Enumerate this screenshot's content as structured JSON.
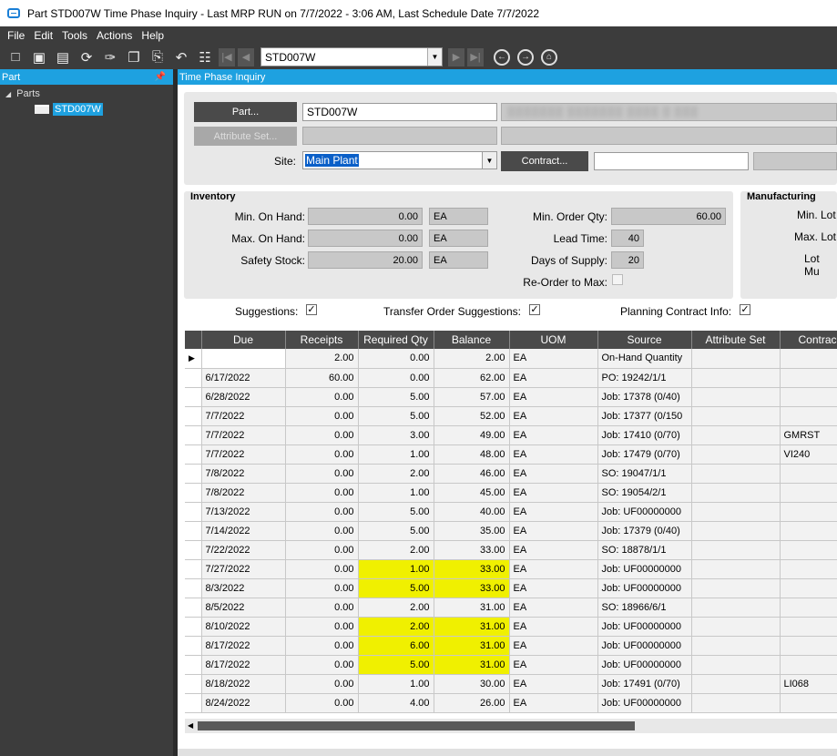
{
  "window": {
    "title": "Part STD007W Time Phase Inquiry  - Last MRP RUN on 7/7/2022 - 3:06 AM, Last Schedule Date  7/7/2022"
  },
  "menu": [
    "File",
    "Edit",
    "Tools",
    "Actions",
    "Help"
  ],
  "toolbar": {
    "part_combo": "STD007W"
  },
  "left": {
    "header": "Part",
    "root": "Parts",
    "item": "STD007W"
  },
  "main": {
    "header": "Time Phase Inquiry",
    "part_button": "Part...",
    "part_value": "STD007W",
    "part_desc": "░░░░░░░ ░░░░░░░ ░░░░ ░ ░░░",
    "attr_button": "Attribute Set...",
    "site_label": "Site:",
    "site_value": "Main Plant",
    "contract_button": "Contract..."
  },
  "inventory": {
    "title": "Inventory",
    "min_on_hand_label": "Min. On Hand:",
    "min_on_hand": "0.00",
    "min_on_hand_uom": "EA",
    "max_on_hand_label": "Max. On Hand:",
    "max_on_hand": "0.00",
    "max_on_hand_uom": "EA",
    "safety_label": "Safety Stock:",
    "safety": "20.00",
    "safety_uom": "EA",
    "min_order_label": "Min. Order Qty:",
    "min_order": "60.00",
    "lead_label": "Lead Time:",
    "lead": "40",
    "days_label": "Days of Supply:",
    "days": "20",
    "reorder_label": "Re-Order to Max:"
  },
  "manufacturing": {
    "title": "Manufacturing",
    "min_lot": "Min. Lot",
    "max_lot": "Max. Lot",
    "lot_mu": "Lot Mu"
  },
  "options": {
    "suggestions": "Suggestions:",
    "transfer": "Transfer Order Suggestions:",
    "planning": "Planning Contract Info:",
    "check": "✓"
  },
  "grid": {
    "columns": [
      "Due",
      "Receipts",
      "Required Qty",
      "Balance",
      "UOM",
      "Source",
      "Attribute Set",
      "Contrac"
    ],
    "rows": [
      {
        "due": "",
        "receipts": "2.00",
        "req": "0.00",
        "bal": "2.00",
        "uom": "EA",
        "source": "On-Hand Quantity",
        "attr": "",
        "contract": ""
      },
      {
        "due": "6/17/2022",
        "receipts": "60.00",
        "req": "0.00",
        "bal": "62.00",
        "uom": "EA",
        "source": "PO: 19242/1/1",
        "attr": "",
        "contract": ""
      },
      {
        "due": "6/28/2022",
        "receipts": "0.00",
        "req": "5.00",
        "bal": "57.00",
        "uom": "EA",
        "source": "Job: 17378 (0/40)",
        "attr": "",
        "contract": ""
      },
      {
        "due": "7/7/2022",
        "receipts": "0.00",
        "req": "5.00",
        "bal": "52.00",
        "uom": "EA",
        "source": "Job: 17377 (0/150",
        "attr": "",
        "contract": ""
      },
      {
        "due": "7/7/2022",
        "receipts": "0.00",
        "req": "3.00",
        "bal": "49.00",
        "uom": "EA",
        "source": "Job: 17410 (0/70)",
        "attr": "",
        "contract": "GMRST"
      },
      {
        "due": "7/7/2022",
        "receipts": "0.00",
        "req": "1.00",
        "bal": "48.00",
        "uom": "EA",
        "source": "Job: 17479 (0/70)",
        "attr": "",
        "contract": "VI240"
      },
      {
        "due": "7/8/2022",
        "receipts": "0.00",
        "req": "2.00",
        "bal": "46.00",
        "uom": "EA",
        "source": "SO: 19047/1/1",
        "attr": "",
        "contract": ""
      },
      {
        "due": "7/8/2022",
        "receipts": "0.00",
        "req": "1.00",
        "bal": "45.00",
        "uom": "EA",
        "source": "SO: 19054/2/1",
        "attr": "",
        "contract": ""
      },
      {
        "due": "7/13/2022",
        "receipts": "0.00",
        "req": "5.00",
        "bal": "40.00",
        "uom": "EA",
        "source": "Job: UF00000000",
        "attr": "",
        "contract": ""
      },
      {
        "due": "7/14/2022",
        "receipts": "0.00",
        "req": "5.00",
        "bal": "35.00",
        "uom": "EA",
        "source": "Job: 17379 (0/40)",
        "attr": "",
        "contract": ""
      },
      {
        "due": "7/22/2022",
        "receipts": "0.00",
        "req": "2.00",
        "bal": "33.00",
        "uom": "EA",
        "source": "SO: 18878/1/1",
        "attr": "",
        "contract": ""
      },
      {
        "due": "7/27/2022",
        "receipts": "0.00",
        "req": "1.00",
        "bal": "33.00",
        "uom": "EA",
        "source": "Job: UF00000000",
        "attr": "",
        "contract": "",
        "hl": true
      },
      {
        "due": "8/3/2022",
        "receipts": "0.00",
        "req": "5.00",
        "bal": "33.00",
        "uom": "EA",
        "source": "Job: UF00000000",
        "attr": "",
        "contract": "",
        "hl": true
      },
      {
        "due": "8/5/2022",
        "receipts": "0.00",
        "req": "2.00",
        "bal": "31.00",
        "uom": "EA",
        "source": "SO: 18966/6/1",
        "attr": "",
        "contract": ""
      },
      {
        "due": "8/10/2022",
        "receipts": "0.00",
        "req": "2.00",
        "bal": "31.00",
        "uom": "EA",
        "source": "Job: UF00000000",
        "attr": "",
        "contract": "",
        "hl": true
      },
      {
        "due": "8/17/2022",
        "receipts": "0.00",
        "req": "6.00",
        "bal": "31.00",
        "uom": "EA",
        "source": "Job: UF00000000",
        "attr": "",
        "contract": "",
        "hl": true
      },
      {
        "due": "8/17/2022",
        "receipts": "0.00",
        "req": "5.00",
        "bal": "31.00",
        "uom": "EA",
        "source": "Job: UF00000000",
        "attr": "",
        "contract": "",
        "hl": true
      },
      {
        "due": "8/18/2022",
        "receipts": "0.00",
        "req": "1.00",
        "bal": "30.00",
        "uom": "EA",
        "source": "Job: 17491 (0/70)",
        "attr": "",
        "contract": "LI068"
      },
      {
        "due": "8/24/2022",
        "receipts": "0.00",
        "req": "4.00",
        "bal": "26.00",
        "uom": "EA",
        "source": "Job: UF00000000",
        "attr": "",
        "contract": ""
      }
    ]
  }
}
